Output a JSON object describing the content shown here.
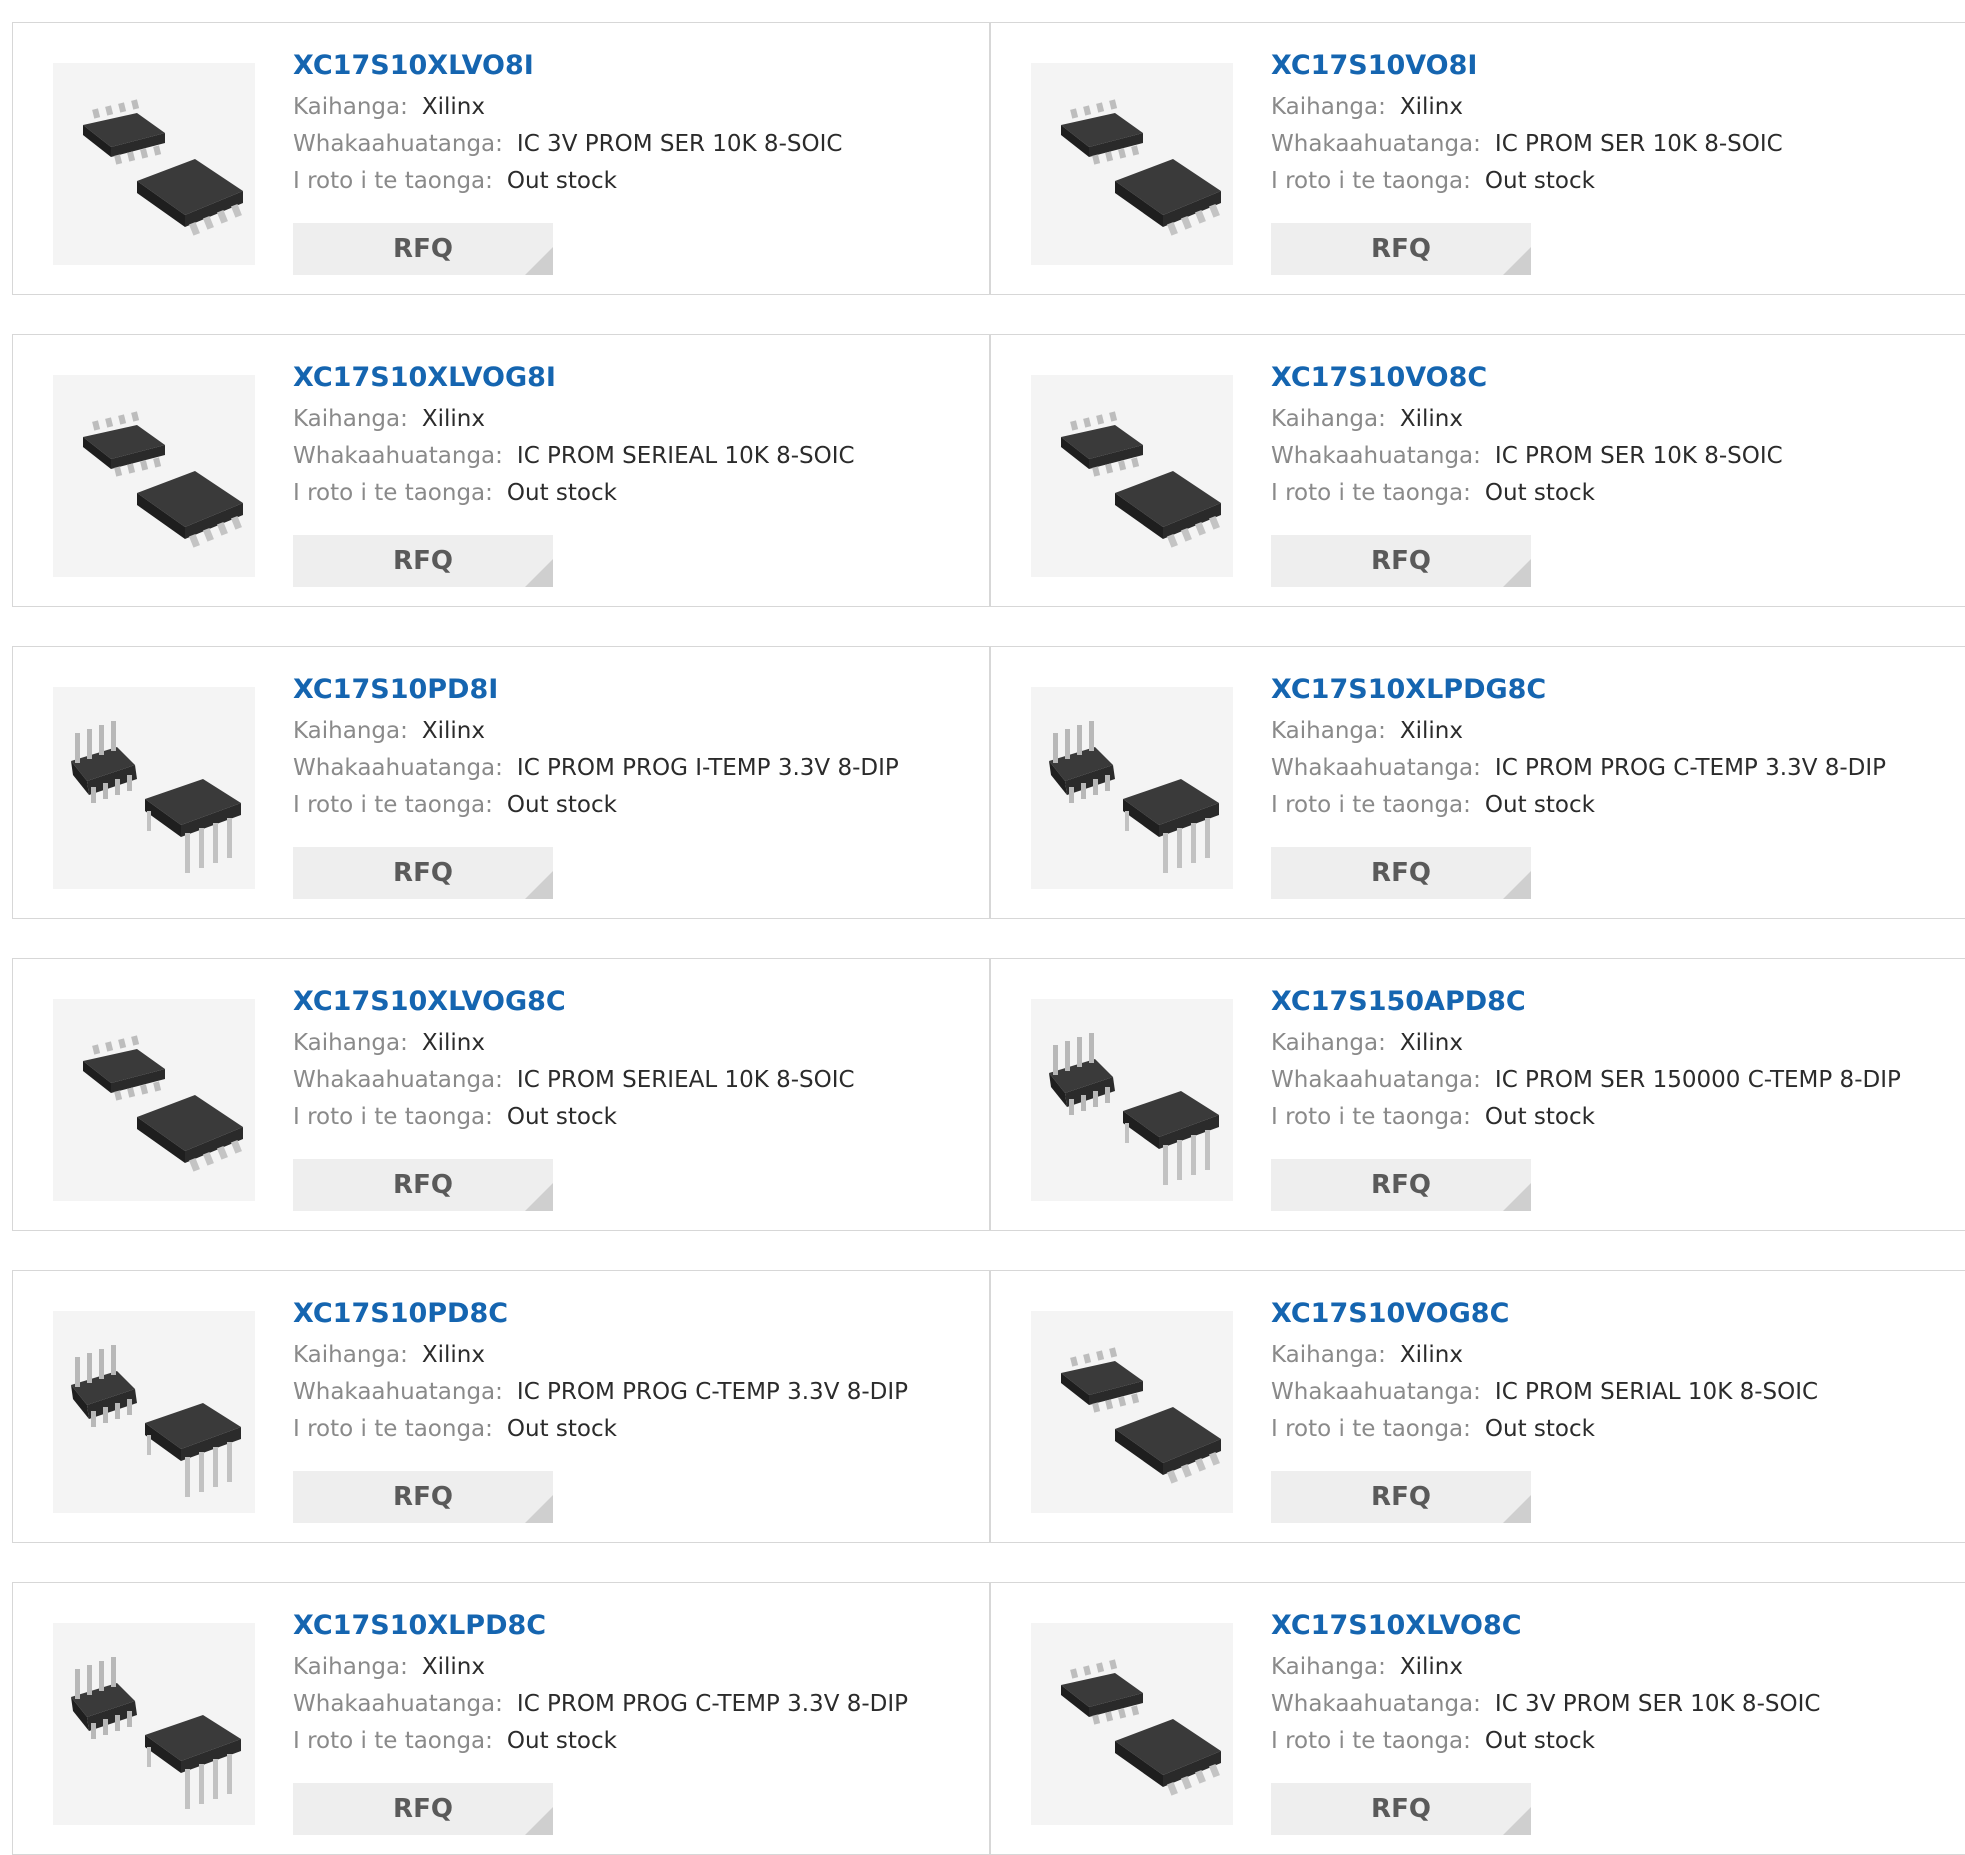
{
  "labels": {
    "manufacturer": "Kaihanga:",
    "description": "Whakaahuatanga:",
    "stock": "I roto i te taonga:",
    "rfq": "RFQ"
  },
  "products": [
    {
      "part": "XC17S10XLVO8I",
      "manufacturer": "Xilinx",
      "description": "IC 3V PROM SER 10K 8-SOIC",
      "stock": "Out stock",
      "package": "soic"
    },
    {
      "part": "XC17S10VO8I",
      "manufacturer": "Xilinx",
      "description": "IC PROM SER 10K 8-SOIC",
      "stock": "Out stock",
      "package": "soic"
    },
    {
      "part": "XC17S10XLVOG8I",
      "manufacturer": "Xilinx",
      "description": "IC PROM SERIEAL 10K 8-SOIC",
      "stock": "Out stock",
      "package": "soic"
    },
    {
      "part": "XC17S10VO8C",
      "manufacturer": "Xilinx",
      "description": "IC PROM SER 10K 8-SOIC",
      "stock": "Out stock",
      "package": "soic"
    },
    {
      "part": "XC17S10PD8I",
      "manufacturer": "Xilinx",
      "description": "IC PROM PROG I-TEMP 3.3V 8-DIP",
      "stock": "Out stock",
      "package": "dip"
    },
    {
      "part": "XC17S10XLPDG8C",
      "manufacturer": "Xilinx",
      "description": "IC PROM PROG C-TEMP 3.3V 8-DIP",
      "stock": "Out stock",
      "package": "dip"
    },
    {
      "part": "XC17S10XLVOG8C",
      "manufacturer": "Xilinx",
      "description": "IC PROM SERIEAL 10K 8-SOIC",
      "stock": "Out stock",
      "package": "soic"
    },
    {
      "part": "XC17S150APD8C",
      "manufacturer": "Xilinx",
      "description": "IC PROM SER 150000 C-TEMP 8-DIP",
      "stock": "Out stock",
      "package": "dip"
    },
    {
      "part": "XC17S10PD8C",
      "manufacturer": "Xilinx",
      "description": "IC PROM PROG C-TEMP 3.3V 8-DIP",
      "stock": "Out stock",
      "package": "dip"
    },
    {
      "part": "XC17S10VOG8C",
      "manufacturer": "Xilinx",
      "description": "IC PROM SERIAL 10K 8-SOIC",
      "stock": "Out stock",
      "package": "soic"
    },
    {
      "part": "XC17S10XLPD8C",
      "manufacturer": "Xilinx",
      "description": "IC PROM PROG C-TEMP 3.3V 8-DIP",
      "stock": "Out stock",
      "package": "dip"
    },
    {
      "part": "XC17S10XLVO8C",
      "manufacturer": "Xilinx",
      "description": "IC 3V PROM SER 10K 8-SOIC",
      "stock": "Out stock",
      "package": "soic"
    }
  ],
  "colors": {
    "link": "#1565b0",
    "label": "#8a8a8a",
    "value": "#2b2b2b",
    "button_bg": "#eeeeee",
    "border": "#d7d7d7"
  }
}
